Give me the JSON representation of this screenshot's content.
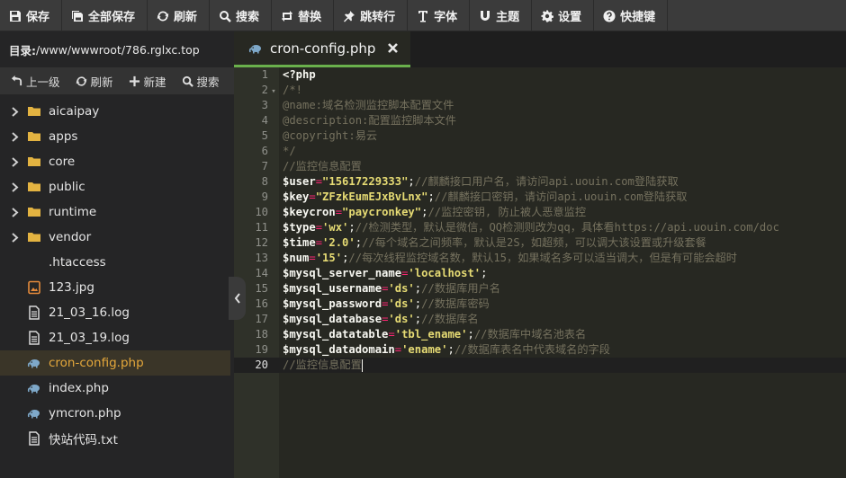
{
  "toolbar": {
    "items": [
      {
        "label": "保存",
        "icon": "save-icon"
      },
      {
        "label": "全部保存",
        "icon": "save-all-icon"
      },
      {
        "label": "刷新",
        "icon": "refresh-icon"
      },
      {
        "label": "搜索",
        "icon": "search-icon"
      },
      {
        "label": "替换",
        "icon": "replace-icon"
      },
      {
        "label": "跳转行",
        "icon": "pin-icon"
      },
      {
        "label": "字体",
        "icon": "font-icon"
      },
      {
        "label": "主题",
        "icon": "magnet-icon"
      },
      {
        "label": "设置",
        "icon": "gear-icon"
      },
      {
        "label": "快捷键",
        "icon": "help-icon"
      }
    ]
  },
  "sidebar": {
    "dir_label": "目录:",
    "dir_path": "/www/wwwroot/786.rglxc.top",
    "tools": [
      {
        "label": "上一级",
        "icon": "up-arrow-icon"
      },
      {
        "label": "刷新",
        "icon": "refresh-icon"
      },
      {
        "label": "新建",
        "icon": "plus-icon"
      },
      {
        "label": "搜索",
        "icon": "search-icon"
      }
    ],
    "items": [
      {
        "name": "aicaipay",
        "type": "folder"
      },
      {
        "name": "apps",
        "type": "folder"
      },
      {
        "name": "core",
        "type": "folder"
      },
      {
        "name": "public",
        "type": "folder"
      },
      {
        "name": "runtime",
        "type": "folder"
      },
      {
        "name": "vendor",
        "type": "folder"
      },
      {
        "name": ".htaccess",
        "type": "plain"
      },
      {
        "name": "123.jpg",
        "type": "image"
      },
      {
        "name": "21_03_16.log",
        "type": "doc"
      },
      {
        "name": "21_03_19.log",
        "type": "doc"
      },
      {
        "name": "cron-config.php",
        "type": "php",
        "active": true
      },
      {
        "name": "index.php",
        "type": "php"
      },
      {
        "name": "ymcron.php",
        "type": "php"
      },
      {
        "name": "快站代码.txt",
        "type": "doc"
      }
    ]
  },
  "tab": {
    "label": "cron-config.php"
  },
  "editor": {
    "lines": [
      [
        [
          "t-plain t-bold",
          "<?php"
        ]
      ],
      [
        [
          "t-com",
          "/*!"
        ]
      ],
      [
        [
          "t-com",
          "@name:域名检测监控脚本配置文件"
        ]
      ],
      [
        [
          "t-com",
          "@description:配置监控脚本文件"
        ]
      ],
      [
        [
          "t-com",
          "@copyright:易云"
        ]
      ],
      [
        [
          "t-com",
          "*/"
        ]
      ],
      [
        [
          "t-com",
          "//监控信息配置"
        ]
      ],
      [
        [
          "t-var t-bold",
          "$user"
        ],
        [
          "t-op",
          "="
        ],
        [
          "t-str t-bold",
          "\"15617229333\""
        ],
        [
          "t-pun",
          ";"
        ],
        [
          "t-com",
          "//麒麟接口用户名，请访问api.uouin.com登陆获取"
        ]
      ],
      [
        [
          "t-var t-bold",
          "$key"
        ],
        [
          "t-op",
          "="
        ],
        [
          "t-str t-bold",
          "\"ZFzkEumEJxBvLnx\""
        ],
        [
          "t-pun",
          ";"
        ],
        [
          "t-com",
          "//麒麟接口密钥，请访问api.uouin.com登陆获取"
        ]
      ],
      [
        [
          "t-var t-bold",
          "$keycron"
        ],
        [
          "t-op",
          "="
        ],
        [
          "t-str t-bold",
          "\"paycronkey\""
        ],
        [
          "t-pun",
          ";"
        ],
        [
          "t-com",
          "//监控密钥, 防止被人恶意监控"
        ]
      ],
      [
        [
          "t-var t-bold",
          "$type"
        ],
        [
          "t-op",
          "="
        ],
        [
          "t-str t-bold",
          "'wx'"
        ],
        [
          "t-pun",
          ";"
        ],
        [
          "t-com",
          "//检测类型，默认是微信，QQ检测则改为qq，具体看https://api.uouin.com/doc"
        ]
      ],
      [
        [
          "t-var t-bold",
          "$time"
        ],
        [
          "t-op",
          "="
        ],
        [
          "t-str t-bold",
          "'2.0'"
        ],
        [
          "t-pun",
          ";"
        ],
        [
          "t-com",
          "//每个域名之间频率，默认是2S，如超频，可以调大该设置或升级套餐"
        ]
      ],
      [
        [
          "t-var t-bold",
          "$num"
        ],
        [
          "t-op",
          "="
        ],
        [
          "t-str t-bold",
          "'15'"
        ],
        [
          "t-pun",
          ";"
        ],
        [
          "t-com",
          "//每次线程监控域名数，默认15，如果域名多可以适当调大，但是有可能会超时"
        ]
      ],
      [
        [
          "t-var t-bold",
          "$mysql_server_name"
        ],
        [
          "t-op",
          "="
        ],
        [
          "t-str t-bold",
          "'localhost'"
        ],
        [
          "t-pun",
          ";"
        ]
      ],
      [
        [
          "t-var t-bold",
          "$mysql_username"
        ],
        [
          "t-op",
          "="
        ],
        [
          "t-str t-bold",
          "'ds'"
        ],
        [
          "t-pun",
          ";"
        ],
        [
          "t-com",
          "//数据库用户名"
        ]
      ],
      [
        [
          "t-var t-bold",
          "$mysql_password"
        ],
        [
          "t-op",
          "="
        ],
        [
          "t-str t-bold",
          "'ds'"
        ],
        [
          "t-pun",
          ";"
        ],
        [
          "t-com",
          "//数据库密码"
        ]
      ],
      [
        [
          "t-var t-bold",
          "$mysql_database"
        ],
        [
          "t-op",
          "="
        ],
        [
          "t-str t-bold",
          "'ds'"
        ],
        [
          "t-pun",
          ";"
        ],
        [
          "t-com",
          "//数据库名"
        ]
      ],
      [
        [
          "t-var t-bold",
          "$mysql_datatable"
        ],
        [
          "t-op",
          "="
        ],
        [
          "t-str t-bold",
          "'tbl_ename'"
        ],
        [
          "t-pun",
          ";"
        ],
        [
          "t-com",
          "//数据库中域名池表名"
        ]
      ],
      [
        [
          "t-var t-bold",
          "$mysql_datadomain"
        ],
        [
          "t-op",
          "="
        ],
        [
          "t-str t-bold",
          "'ename'"
        ],
        [
          "t-pun",
          ";"
        ],
        [
          "t-com",
          "//数据库表名中代表域名的字段"
        ]
      ],
      [
        [
          "t-com",
          "//监控信息配置"
        ]
      ]
    ]
  },
  "colors": {
    "accent_green": "#6ab04c",
    "active_file": "#e5a83b",
    "folder": "#e3b341",
    "php_icon": "#7ea8c9"
  }
}
